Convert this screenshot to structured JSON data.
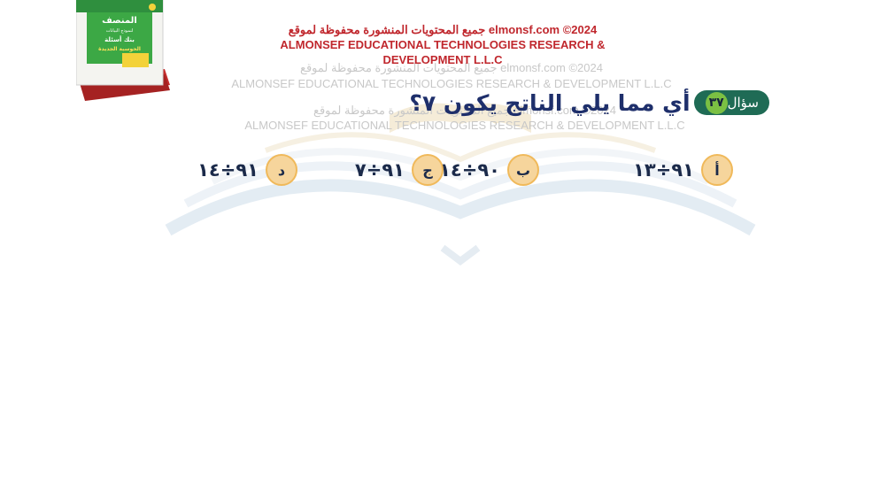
{
  "book": {
    "title_line1": "المنصف",
    "title_line2": "لنموذج البيانات",
    "title_line3": "بنك أسئلة",
    "title_line4": "الحوسبة الجديدة"
  },
  "copyright": {
    "line1": "جميع المحتويات المنشورة محفوظة لموقع elmonsf.com  ©2024",
    "line2": "ALMONSEF  EDUCATIONAL  TECHNOLOGIES  RESEARCH  &",
    "line3": "DEVELOPMENT  L.L.C"
  },
  "watermark": {
    "line1": "جميع المحتويات المنشورة محفوظة لموقع elmonsf.com  ©2024",
    "line2": "ALMONSEF  EDUCATIONAL  TECHNOLOGIES  RESEARCH & DEVELOPMENT  L.L.C",
    "line3": "جميع المحتويات المنشورة محفوظة لموقع elmonsf.com  ©2024",
    "line4": "ALMONSEF  EDUCATIONAL  TECHNOLOGIES  RESEARCH & DEVELOPMENT  L.L.C"
  },
  "question": {
    "badge_label": "سؤال",
    "number": "٣٧",
    "text": "أي مما يلي الناتج يكون ٧؟"
  },
  "options": [
    {
      "letter": "أ",
      "value": "٩١÷١٣"
    },
    {
      "letter": "ب",
      "value": "٩٠÷١٤"
    },
    {
      "letter": "ج",
      "value": "٩١÷٧"
    },
    {
      "letter": "د",
      "value": "٩١÷١٤"
    }
  ],
  "colors": {
    "badge": "#1f6b55",
    "badge_number": "#7bc043",
    "question_text": "#1e2f6b",
    "option_circle": "#f6d59c",
    "copyright_red": "#c0272d"
  }
}
